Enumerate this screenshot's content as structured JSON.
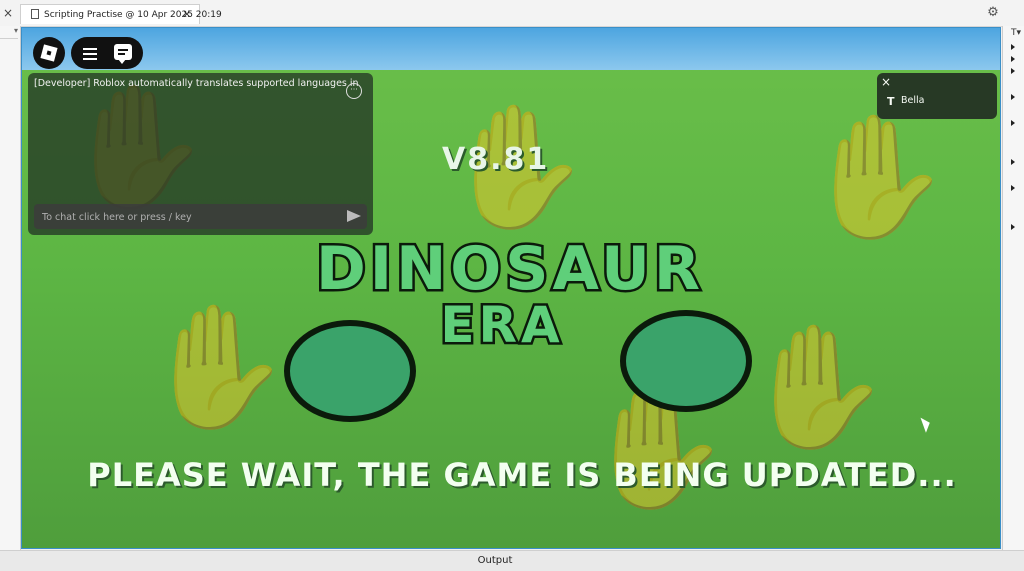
{
  "tab": {
    "close_glyph": "×",
    "title": "Scripting Practise @ 10 Apr 2025 20:19",
    "tab_close": "×"
  },
  "toolbar": {
    "settings_icon": "gear-icon",
    "settings_glyph": "⚙"
  },
  "rightpanel": {
    "filter_glyph": "T▾"
  },
  "game": {
    "version": "V8.81",
    "title": "DINOSAUR",
    "subtitle": "ERA",
    "status": "PLEASE WAIT, THE GAME IS BEING UPDATED..."
  },
  "chat": {
    "message": "[Developer] Roblox automatically translates supported languages in chat",
    "more_glyph": "···",
    "placeholder": "To chat click here or press / key"
  },
  "players": {
    "close_glyph": "×",
    "icon_glyph": "T",
    "name": "Bella"
  },
  "bottom": {
    "output_label": "Output"
  },
  "colors": {
    "accent": "#3a8fc8",
    "grass": "#5db644",
    "title_fill": "#5fcf7a"
  }
}
